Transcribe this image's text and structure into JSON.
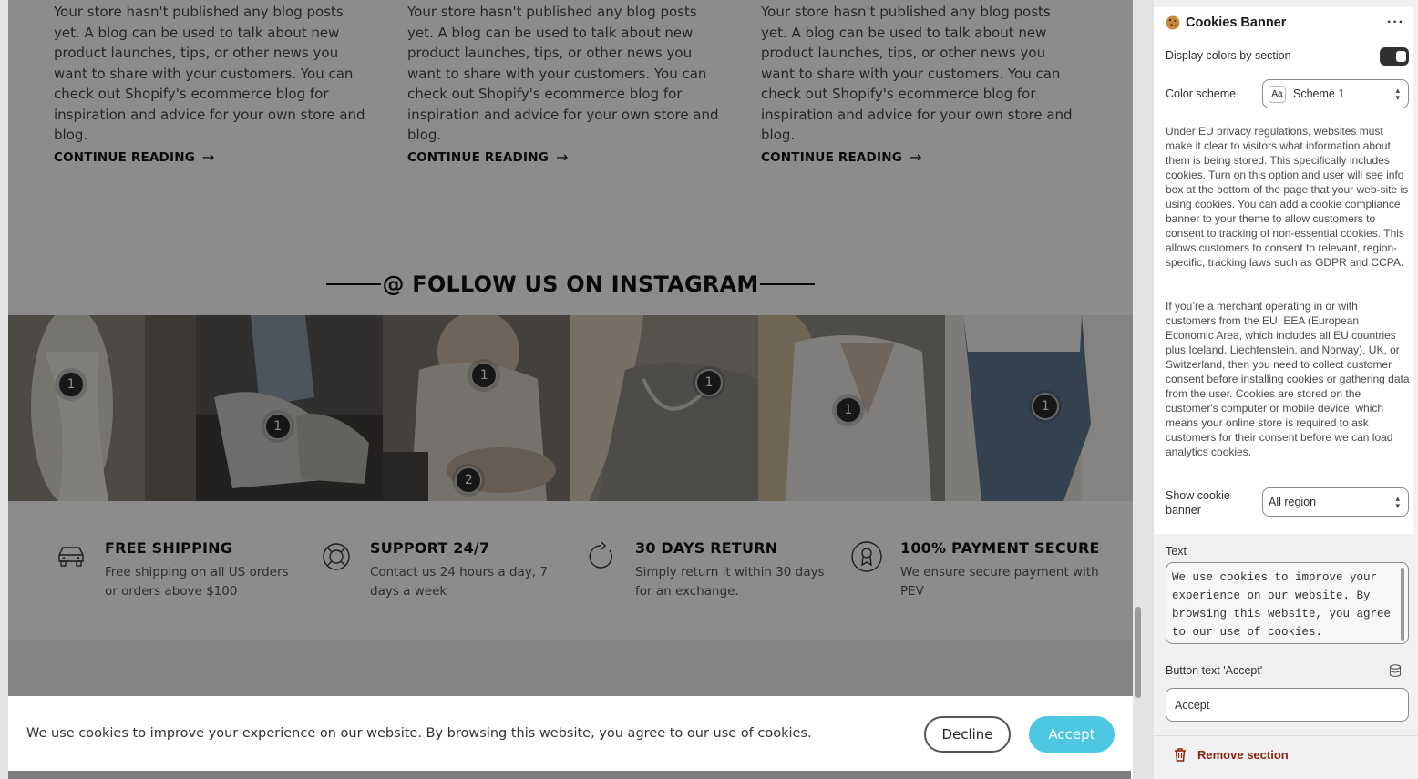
{
  "blog": {
    "excerpt": "Your store hasn't published any blog posts yet. A blog can be used to talk about new product launches, tips, or other news you want to share with your customers. You can check out Shopify's ecommerce blog for inspiration and advice for your own store and blog.",
    "continue_label": "CONTINUE READING",
    "arrow": "→"
  },
  "instagram": {
    "heading": "@ FOLLOW US ON INSTAGRAM",
    "hotspots": [
      "1",
      "1",
      "1",
      "2",
      "1",
      "1",
      "1"
    ]
  },
  "features": [
    {
      "icon": "car-icon",
      "title": "FREE SHIPPING",
      "desc": "Free shipping on all US orders or orders above $100"
    },
    {
      "icon": "lifebuoy-icon",
      "title": "SUPPORT 24/7",
      "desc": "Contact us 24 hours a day, 7 days a week"
    },
    {
      "icon": "refresh-icon",
      "title": "30 DAYS RETURN",
      "desc": "Simply return it within 30 days for an exchange."
    },
    {
      "icon": "secure-badge-icon",
      "title": "100% PAYMENT SECURE",
      "desc": "We ensure secure payment with PEV"
    }
  ],
  "cookie_banner": {
    "text": "We use cookies to improve your experience on our website. By browsing this website, you agree to our use of cookies.",
    "decline": "Decline",
    "accept": "Accept",
    "accent_color": "#4dc7e2"
  },
  "panel": {
    "title": "Cookies Banner",
    "more": "···",
    "display_colors_label": "Display colors by section",
    "display_colors_on": true,
    "color_scheme_label": "Color scheme",
    "color_scheme_icon": "Aa",
    "color_scheme_value": "Scheme 1",
    "info_1": "Under EU privacy regulations, websites must make it clear to visitors what information about them is being stored. This specifically includes cookies. Turn on this option and user will see info box at the bottom of the page that your web-site is using cookies. You can add a cookie compliance banner to your theme to allow customers to consent to tracking of non-essential cookies. This allows customers to consent to relevant, region-specific, tracking laws such as GDPR and CCPA.",
    "info_2": "If you’re a merchant operating in or with customers from the EU, EEA (European Economic Area, which includes all EU countries plus Iceland, Liechtenstein, and Norway), UK, or Switzerland, then you need to collect customer consent before installing cookies or gathering data from the user. Cookies are stored on the customer's computer or mobile device, which means your online store is required to ask customers for their consent before we can load analytics cookies.",
    "show_banner_label": "Show cookie banner",
    "show_banner_value": "All region",
    "text_label": "Text",
    "text_value": "We use cookies to improve your experience on our website. By browsing this website, you agree to our use of cookies.",
    "accept_text_label": "Button text 'Accept'",
    "accept_text_value": "Accept",
    "remove_section": "Remove section",
    "remove_color": "#8e1f0b"
  }
}
